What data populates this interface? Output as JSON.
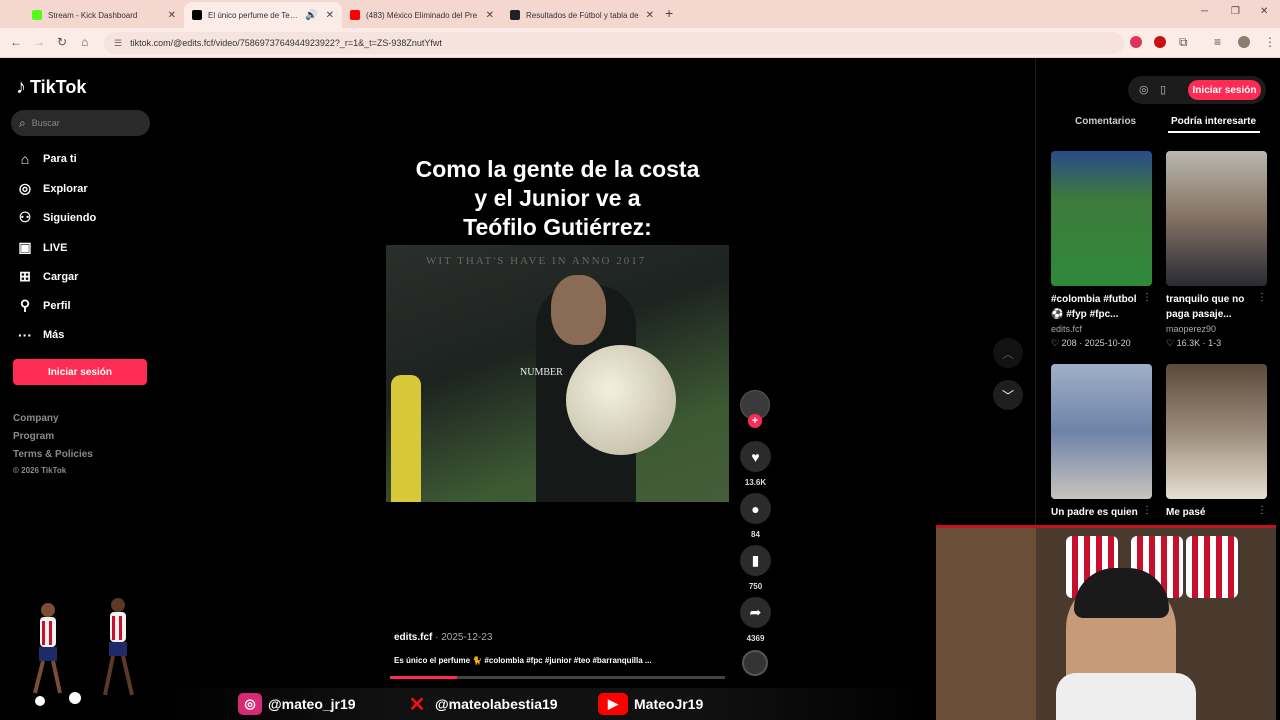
{
  "browser": {
    "tabs": [
      {
        "title": "Stream - Kick Dashboard",
        "favicon_color": "#53fc18",
        "active": false
      },
      {
        "title": "El único perfume de Teófilo",
        "favicon_color": "#000000",
        "active": true
      },
      {
        "title": "(483) México Eliminado del Pre",
        "favicon_color": "#ff0000",
        "active": false
      },
      {
        "title": "Resultados de Fútbol y tabla de",
        "favicon_color": "#222222",
        "active": false
      }
    ],
    "new_tab": "+",
    "url": "tiktok.com/@edits.fcf/video/7586973764944923922?_r=1&_t=ZS-938ZnutYfwt"
  },
  "sidebar": {
    "logo": "TikTok",
    "search_placeholder": "Buscar",
    "nav": [
      {
        "label": "Para ti",
        "icon": "home-icon"
      },
      {
        "label": "Explorar",
        "icon": "compass-icon"
      },
      {
        "label": "Siguiendo",
        "icon": "following-icon"
      },
      {
        "label": "LIVE",
        "icon": "live-icon"
      },
      {
        "label": "Cargar",
        "icon": "upload-icon"
      },
      {
        "label": "Perfil",
        "icon": "profile-icon"
      },
      {
        "label": "Más",
        "icon": "more-icon"
      }
    ],
    "login_button": "Iniciar sesión",
    "footer": [
      "Company",
      "Program",
      "Terms & Policies"
    ],
    "copyright": "© 2026 TikTok"
  },
  "video": {
    "overlay_caption_lines": [
      "Como la gente de la costa",
      "y el Junior ve a",
      "Teófilo Gutiérrez:"
    ],
    "watermark": "NUMBER",
    "banner": "WIT THAT'S HAVE  IN ANNO 2017",
    "author": "edits.fcf",
    "date": "· 2025-12-23",
    "description": "Es único el perfume 🐈 #colombia #fpc #junior #teo #barranquilla ...",
    "progress": 0.2,
    "likes": "13.6K",
    "comments": "84",
    "saves": "750",
    "shares": "4369"
  },
  "right_panel": {
    "login_button": "Iniciar sesión",
    "tabs": [
      "Comentarios",
      "Podría interesarte"
    ],
    "active_tab": "Podría interesarte",
    "cards": [
      {
        "title": "#colombia #futbol ⚽ #fyp #fpc...",
        "author": "edits.fcf",
        "likes": "208",
        "date": "2025-10-20"
      },
      {
        "title": "tranquilo que no paga pasaje...",
        "author": "maoperez90",
        "likes": "16.3K",
        "date": "1-3"
      },
      {
        "title": "Un padre es quien",
        "author": "",
        "likes": "",
        "date": ""
      },
      {
        "title": "Me pasé",
        "author": "",
        "likes": "",
        "date": ""
      }
    ]
  },
  "stream_overlay": {
    "instagram": "@mateo_jr19",
    "x": "@mateolabestia19",
    "youtube": "MateoJr19"
  },
  "colors": {
    "accent": "#fe2c55",
    "tabstrip": "#f4d8d0",
    "background": "#000000"
  }
}
